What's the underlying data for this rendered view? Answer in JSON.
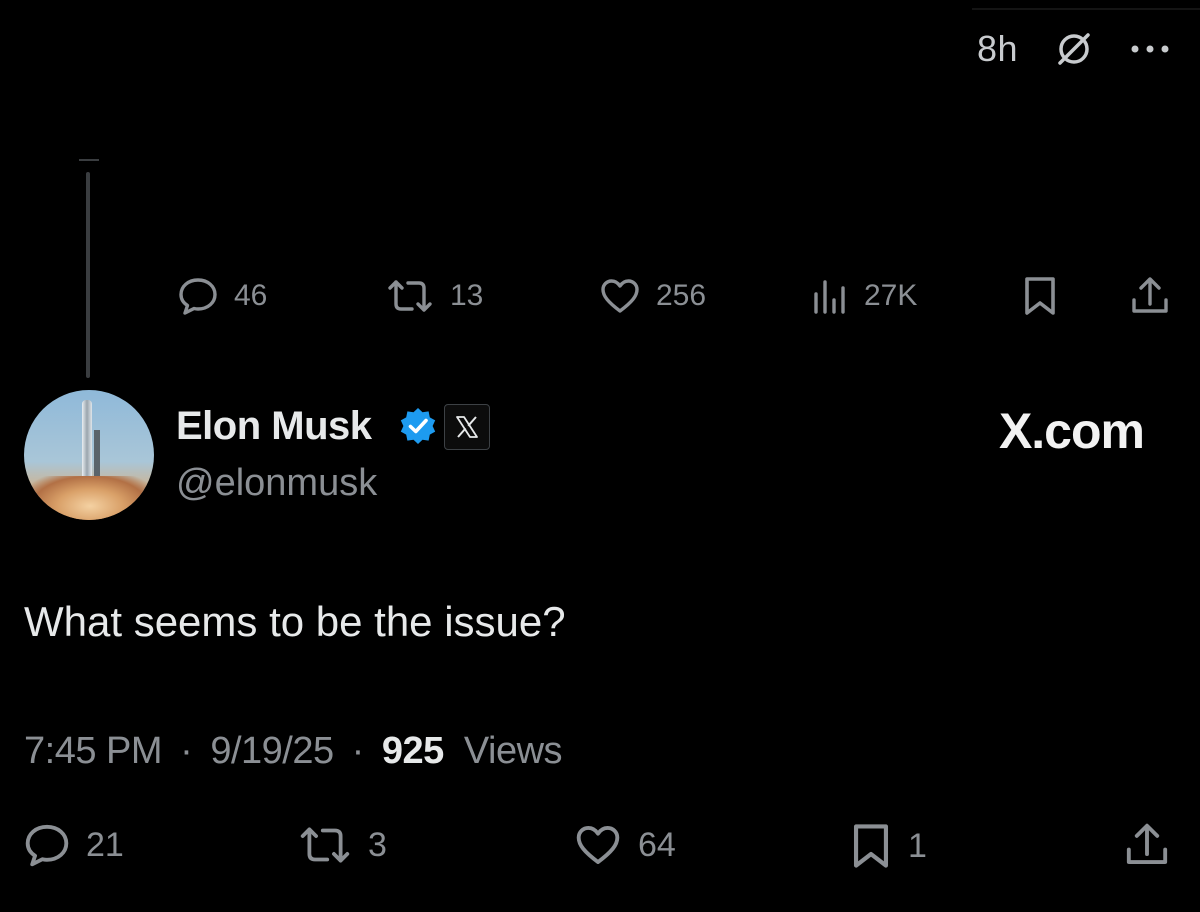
{
  "header": {
    "relative_time": "8h",
    "grok_icon": "grok-icon",
    "more_icon": "more-icon"
  },
  "parent_actions": {
    "replies": "46",
    "reposts": "13",
    "likes": "256",
    "views": "27K"
  },
  "author": {
    "name": "Elon Musk",
    "handle": "@elonmusk",
    "verified_color": "#1d9bf0"
  },
  "watermark": "X.com",
  "tweet": {
    "text": "What seems to be the issue?",
    "time": "7:45 PM",
    "date": "9/19/25",
    "separator": "·",
    "views_count": "925",
    "views_label": "Views"
  },
  "tweet_actions": {
    "replies": "21",
    "reposts": "3",
    "likes": "64",
    "bookmarks": "1"
  }
}
